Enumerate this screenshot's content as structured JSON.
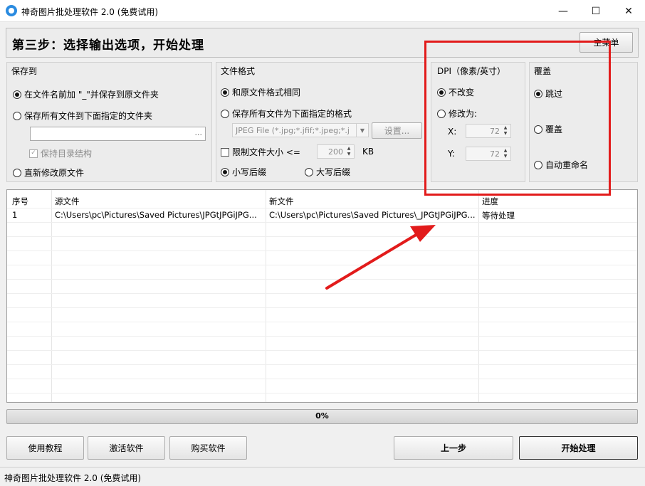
{
  "window": {
    "title": "神奇图片批处理软件 2.0 (免费试用)",
    "controls": {
      "minimize": "—",
      "maximize": "☐",
      "close": "✕"
    }
  },
  "step": {
    "title": "第三步：选择输出选项，开始处理",
    "main_menu_label": "主菜单"
  },
  "save_to": {
    "title": "保存到",
    "option_prefix": "在文件名前加 \"_\"并保存到原文件夹",
    "option_folder": "保存所有文件到下面指定的文件夹",
    "folder_value": "",
    "browse_label": "...",
    "keep_structure": "保持目录结构",
    "option_overwrite": "直新修改原文件"
  },
  "file_format": {
    "title": "文件格式",
    "option_same": "和原文件格式相同",
    "option_specified": "保存所有文件为下面指定的格式",
    "format_value": "JPEG File (*.jpg;*.jfif;*.jpeg;*.j",
    "settings_label": "设置...",
    "limit_size_label": "限制文件大小  <=",
    "limit_size_value": "200",
    "limit_size_unit": "KB",
    "option_lowercase": "小写后缀",
    "option_uppercase": "大写后缀"
  },
  "dpi": {
    "title": "DPI（像素/英寸）",
    "option_keep": "不改变",
    "option_change": "修改为:",
    "x_label": "X:",
    "x_value": "72",
    "y_label": "Y:",
    "y_value": "72"
  },
  "overwrite": {
    "title": "覆盖",
    "option_skip": "跳过",
    "option_overwrite": "覆盖",
    "option_rename": "自动重命名"
  },
  "table": {
    "headers": {
      "index": "序号",
      "source": "源文件",
      "target": "新文件",
      "progress": "进度"
    },
    "rows": [
      {
        "index": "1",
        "source": "C:\\Users\\pc\\Pictures\\Saved Pictures\\JPGtJPGiJPG...",
        "target": "C:\\Users\\pc\\Pictures\\Saved Pictures\\_JPGtJPGiJPG...",
        "progress": "等待处理"
      }
    ]
  },
  "progress": {
    "label": "0%",
    "fraction": 0
  },
  "buttons": {
    "tutorial": "使用教程",
    "activate": "激活软件",
    "buy": "购买软件",
    "prev": "上一步",
    "start": "开始处理"
  },
  "status_bar": {
    "text": "神奇图片批处理软件 2.0 (免费试用)"
  },
  "annotation_colors": {
    "highlight": "#e21b1b"
  }
}
